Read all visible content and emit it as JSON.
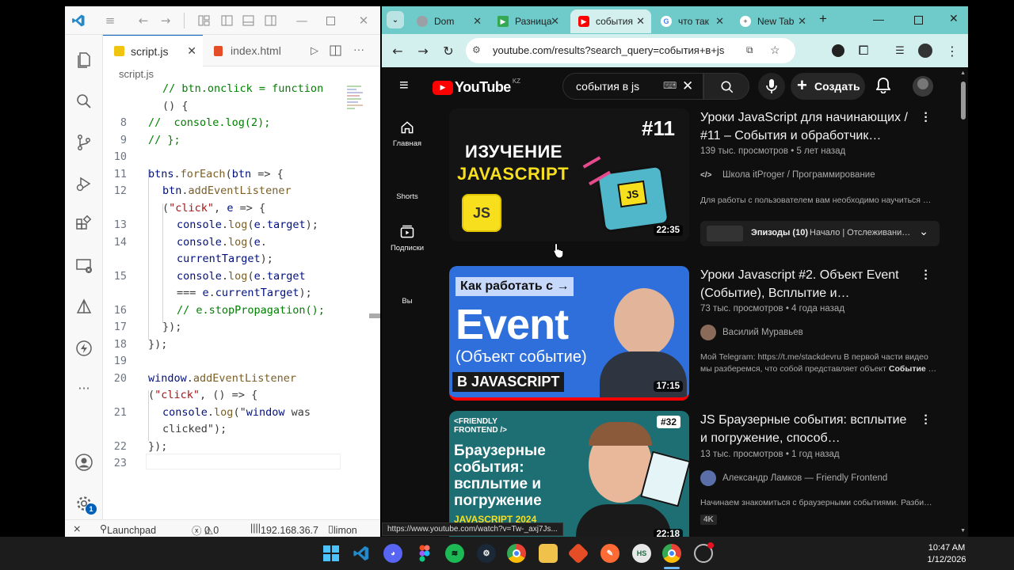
{
  "vscode": {
    "tabs": [
      {
        "label": "script.js",
        "icon": "js-file-icon"
      },
      {
        "label": "index.html",
        "icon": "html-file-icon"
      }
    ],
    "breadcrumb": "script.js",
    "code_lines": [
      {
        "num": "",
        "text": "// btn.onclick = function"
      },
      {
        "num": "",
        "text": "() {"
      },
      {
        "num": "8",
        "text": "//  console.log(2);"
      },
      {
        "num": "9",
        "text": "// };"
      },
      {
        "num": "10",
        "text": ""
      },
      {
        "num": "11",
        "text": "btns.forEach(btn => {"
      },
      {
        "num": "12",
        "text": "btn.addEventListener"
      },
      {
        "num": "",
        "text": "(\"click\", e => {"
      },
      {
        "num": "13",
        "text": "console.log(e.target);"
      },
      {
        "num": "14",
        "text": "console.log(e."
      },
      {
        "num": "",
        "text": "currentTarget);"
      },
      {
        "num": "15",
        "text": "console.log(e.target"
      },
      {
        "num": "",
        "text": "=== e.currentTarget);"
      },
      {
        "num": "16",
        "text": "// e.stopPropagation();"
      },
      {
        "num": "17",
        "text": "});"
      },
      {
        "num": "18",
        "text": "});"
      },
      {
        "num": "19",
        "text": ""
      },
      {
        "num": "20",
        "text": "window.addEventListener"
      },
      {
        "num": "",
        "text": "(\"click\", () => {"
      },
      {
        "num": "21",
        "text": "console.log(\"window was"
      },
      {
        "num": "",
        "text": "clicked\");"
      },
      {
        "num": "22",
        "text": "});"
      },
      {
        "num": "23",
        "text": ""
      }
    ],
    "status": {
      "launchpad": "Launchpad",
      "errors": "0",
      "warnings": "0",
      "ip": "192.168.36.7",
      "theme": "limon"
    },
    "settings_badge": "1"
  },
  "chrome": {
    "tabs": [
      {
        "label": "Dom",
        "color": "#9aa0a6"
      },
      {
        "label": "Разница",
        "color": "#34a853"
      },
      {
        "label": "события",
        "color": "#ff0000",
        "active": true
      },
      {
        "label": "что так",
        "color": "#4285f4"
      },
      {
        "label": "New Tab",
        "color": "#5f6368"
      }
    ],
    "url": "youtube.com/results?search_query=события+в+js",
    "status_url": "https://www.youtube.com/watch?v=Tw-_axj7Js..."
  },
  "youtube": {
    "logo_text": "YouTube",
    "logo_region": "KZ",
    "search_value": "события в js",
    "create_label": "Создать",
    "sidebar": [
      {
        "label": "Главная",
        "icon": "home-icon"
      },
      {
        "label": "Shorts",
        "icon": "shorts-icon"
      },
      {
        "label": "Подписки",
        "icon": "subscriptions-icon"
      },
      {
        "label": "Вы",
        "icon": "you-icon"
      }
    ],
    "videos": [
      {
        "title": "Уроки JavaScript для начинающих / #11 – События и обработчик…",
        "meta": "139 тыс. просмотров • 5 лет назад",
        "channel": "Школа itProger / Программирование",
        "description": "Для работы с пользователем вам необходимо научиться …",
        "duration": "22:35",
        "thumb_text": [
          "#11",
          "ИЗУЧЕНИЕ",
          "JAVASCRIPT",
          "JS",
          "JS"
        ],
        "episodes_label": "Эпизоды (10)",
        "episodes_sub": "Начало | Отслеживани…"
      },
      {
        "title": "Уроки Javascript #2. Объект Event (Событие), Всплытие и…",
        "meta": "73 тыс. просмотров • 4 года назад",
        "channel": "Василий Муравьев",
        "description_plain": "Мой Telegram: https://t.me/stackdevru В первой части видео мы разберемся, что собой представляет объект ",
        "description_bold": "Событие",
        "description_tail": " …",
        "duration": "17:15",
        "thumb_text": [
          "Как работать с →",
          "Event",
          "(Объект событие)",
          "В JAVASCRIPT"
        ]
      },
      {
        "title": "JS Браузерные события: всплытие и погружение, способ…",
        "meta": "13 тыс. просмотров • 1 год назад",
        "channel": "Александр Ламков — Friendly Frontend",
        "description": "Начинаем знакомиться с браузерными событиями. Разби…",
        "badge": "4K",
        "duration": "22:18",
        "thumb_text": [
          "<FRIENDLY FRONTEND />",
          "#32",
          "Браузерные события: всплытие и погружение",
          "JAVASCRIPT 2024"
        ]
      }
    ]
  },
  "taskbar": {
    "time": "10:47 AM",
    "date": "1/12/2026"
  }
}
